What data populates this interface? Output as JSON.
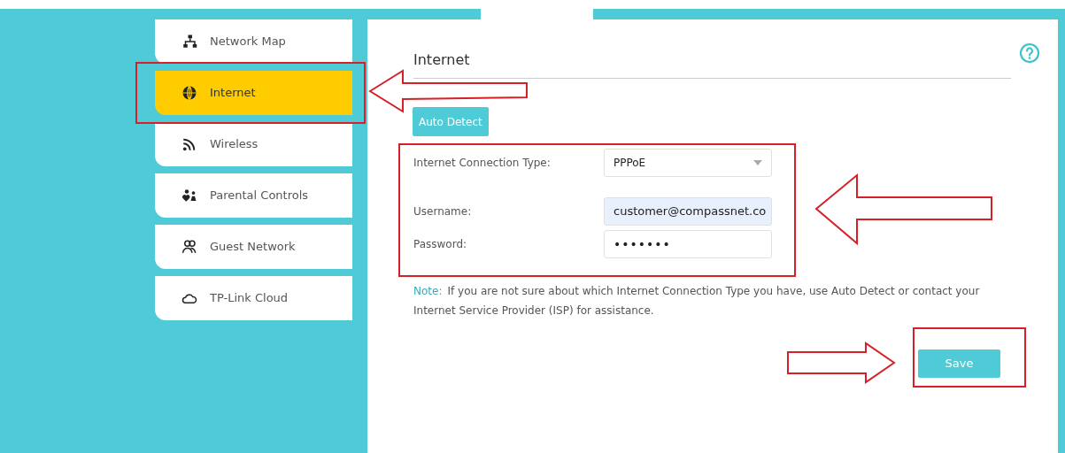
{
  "sidebar": {
    "items": [
      {
        "label": "Network Map",
        "selected": false
      },
      {
        "label": "Internet",
        "selected": true
      },
      {
        "label": "Wireless",
        "selected": false
      },
      {
        "label": "Parental Controls",
        "selected": false
      },
      {
        "label": "Guest Network",
        "selected": false
      },
      {
        "label": "TP-Link Cloud",
        "selected": false
      }
    ]
  },
  "panel": {
    "title": "Internet",
    "auto_detect_button": "Auto Detect",
    "fields": [
      {
        "kind": "select",
        "label": "Internet Connection Type:",
        "value": "PPPoE"
      },
      {
        "kind": "text",
        "label": "Username:",
        "value": "customer@compassnet.co"
      },
      {
        "kind": "password",
        "label": "Password:",
        "value": "•••••••"
      }
    ],
    "note_label": "Note:",
    "note": "If you are not sure about which Internet Connection Type you have, use Auto Detect or contact your Internet Service Provider (ISP) for assistance.",
    "save_button": "Save"
  }
}
